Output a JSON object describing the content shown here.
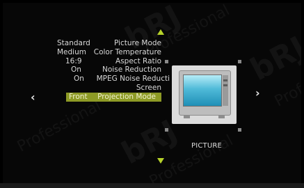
{
  "watermark": {
    "brand": "bRJ",
    "sub": "Professional"
  },
  "menu": {
    "items": [
      {
        "label": "Picture Mode",
        "value": "Standard",
        "selected": false
      },
      {
        "label": "Color Temperature",
        "value": "Medium",
        "selected": false
      },
      {
        "label": "Aspect Ratio",
        "value": "16:9",
        "selected": false
      },
      {
        "label": "Noise Reduction",
        "value": "On",
        "selected": false
      },
      {
        "label": "MPEG Noise Reducti",
        "value": "On",
        "selected": false
      },
      {
        "label": "Screen",
        "value": "",
        "selected": false
      },
      {
        "label": "Projection Mode",
        "value": "Front",
        "selected": true
      }
    ]
  },
  "nav": {
    "left_glyph": "‹",
    "right_glyph": "›"
  },
  "preview": {
    "title": "PICTURE",
    "icon": "tv-icon"
  },
  "colors": {
    "highlight": "#8d9a25",
    "arrow": "#b6d22a",
    "screen_bg": "#070707"
  }
}
